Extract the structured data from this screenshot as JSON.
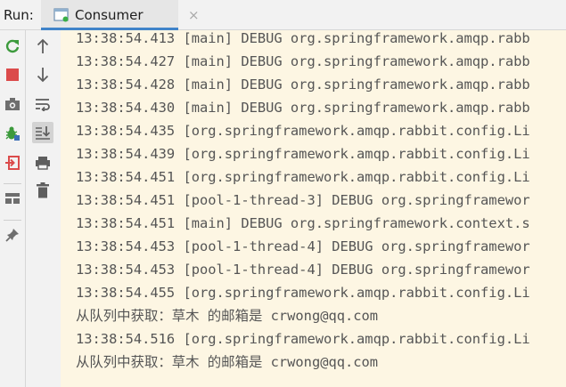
{
  "run": {
    "label": "Run:"
  },
  "tab": {
    "title": "Consumer",
    "close": "×"
  },
  "toolbar_left": [
    {
      "name": "rerun-icon"
    },
    {
      "name": "stop-icon"
    },
    {
      "name": "camera-icon"
    },
    {
      "name": "debug-bug-icon"
    },
    {
      "name": "exit-icon"
    },
    {
      "name": "layout-icon"
    },
    {
      "name": "pin-icon"
    }
  ],
  "toolbar_right": [
    {
      "name": "arrow-up-icon"
    },
    {
      "name": "arrow-down-icon"
    },
    {
      "name": "soft-wrap-icon"
    },
    {
      "name": "scroll-to-end-icon"
    },
    {
      "name": "print-icon"
    },
    {
      "name": "trash-icon"
    }
  ],
  "console": {
    "lines": [
      "13:38:54.413 [main] DEBUG org.springframework.amqp.rabb",
      "13:38:54.427 [main] DEBUG org.springframework.amqp.rabb",
      "13:38:54.428 [main] DEBUG org.springframework.amqp.rabb",
      "13:38:54.430 [main] DEBUG org.springframework.amqp.rabb",
      "13:38:54.435 [org.springframework.amqp.rabbit.config.Li",
      "13:38:54.439 [org.springframework.amqp.rabbit.config.Li",
      "13:38:54.451 [org.springframework.amqp.rabbit.config.Li",
      "13:38:54.451 [pool-1-thread-3] DEBUG org.springframewor",
      "13:38:54.451 [main] DEBUG org.springframework.context.s",
      "13:38:54.453 [pool-1-thread-4] DEBUG org.springframewor",
      "13:38:54.453 [pool-1-thread-4] DEBUG org.springframewor",
      "13:38:54.455 [org.springframework.amqp.rabbit.config.Li",
      "从队列中获取：草木 的邮箱是 crwong@qq.com",
      "13:38:54.516 [org.springframework.amqp.rabbit.config.Li",
      "从队列中获取：草木 的邮箱是 crwong@qq.com"
    ]
  },
  "colors": {
    "console_bg": "#fdf6e3",
    "console_text": "#555555",
    "tab_accent": "#4083c9",
    "rerun": "#3c9a3c",
    "stop": "#db4b4b"
  }
}
